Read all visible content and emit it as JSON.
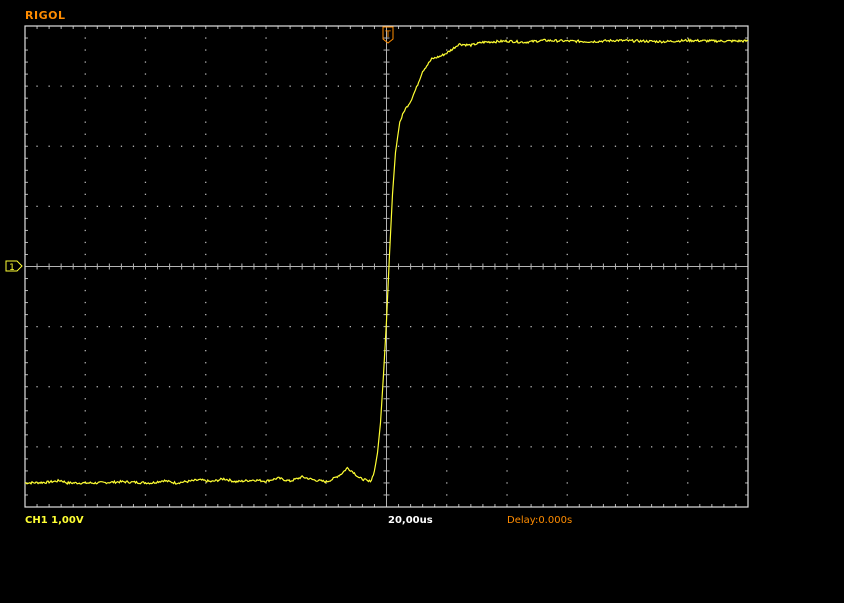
{
  "brand": "RIGOL",
  "status": {
    "channel_scale": "CH1 1,00V",
    "timebase": "20,00us",
    "delay": "Delay:0.000s"
  },
  "channel_marker": "1",
  "trigger_marker": "T",
  "colors": {
    "trace": "#ffff33",
    "grid": "#b4b4b4",
    "brand": "#ff8c00",
    "delay_text": "#ff8c00",
    "background": "#000000"
  },
  "screen": {
    "h_divisions": 12,
    "v_divisions": 8,
    "trigger_position_div": 6
  },
  "waveform": {
    "low_level_div": -3.6,
    "high_level_div": 3.75,
    "samples": [
      [
        0.0,
        -3.6
      ],
      [
        0.35,
        -3.59
      ],
      [
        0.6,
        -3.56
      ],
      [
        0.7,
        -3.6
      ],
      [
        1.2,
        -3.6
      ],
      [
        1.6,
        -3.58
      ],
      [
        2.1,
        -3.6
      ],
      [
        2.3,
        -3.56
      ],
      [
        2.5,
        -3.6
      ],
      [
        2.9,
        -3.55
      ],
      [
        3.1,
        -3.58
      ],
      [
        3.3,
        -3.53
      ],
      [
        3.5,
        -3.58
      ],
      [
        3.8,
        -3.55
      ],
      [
        4.0,
        -3.57
      ],
      [
        4.2,
        -3.52
      ],
      [
        4.4,
        -3.57
      ],
      [
        4.6,
        -3.5
      ],
      [
        4.8,
        -3.55
      ],
      [
        5.0,
        -3.58
      ],
      [
        5.1,
        -3.54
      ],
      [
        5.25,
        -3.45
      ],
      [
        5.35,
        -3.35
      ],
      [
        5.45,
        -3.42
      ],
      [
        5.55,
        -3.52
      ],
      [
        5.65,
        -3.55
      ],
      [
        5.7,
        -3.58
      ],
      [
        5.75,
        -3.55
      ],
      [
        5.8,
        -3.4
      ],
      [
        5.85,
        -3.1
      ],
      [
        5.9,
        -2.6
      ],
      [
        5.95,
        -1.8
      ],
      [
        6.0,
        -0.9
      ],
      [
        6.05,
        0.2
      ],
      [
        6.1,
        1.2
      ],
      [
        6.15,
        1.9
      ],
      [
        6.22,
        2.4
      ],
      [
        6.3,
        2.6
      ],
      [
        6.4,
        2.75
      ],
      [
        6.5,
        2.98
      ],
      [
        6.6,
        3.25
      ],
      [
        6.75,
        3.45
      ],
      [
        6.9,
        3.5
      ],
      [
        7.0,
        3.55
      ],
      [
        7.1,
        3.62
      ],
      [
        7.2,
        3.7
      ],
      [
        7.4,
        3.68
      ],
      [
        7.6,
        3.73
      ],
      [
        7.8,
        3.74
      ],
      [
        8.0,
        3.75
      ],
      [
        8.3,
        3.73
      ],
      [
        8.6,
        3.76
      ],
      [
        9.0,
        3.75
      ],
      [
        9.4,
        3.74
      ],
      [
        9.8,
        3.76
      ],
      [
        10.2,
        3.75
      ],
      [
        10.6,
        3.74
      ],
      [
        11.0,
        3.76
      ],
      [
        11.4,
        3.75
      ],
      [
        12.0,
        3.75
      ]
    ]
  }
}
